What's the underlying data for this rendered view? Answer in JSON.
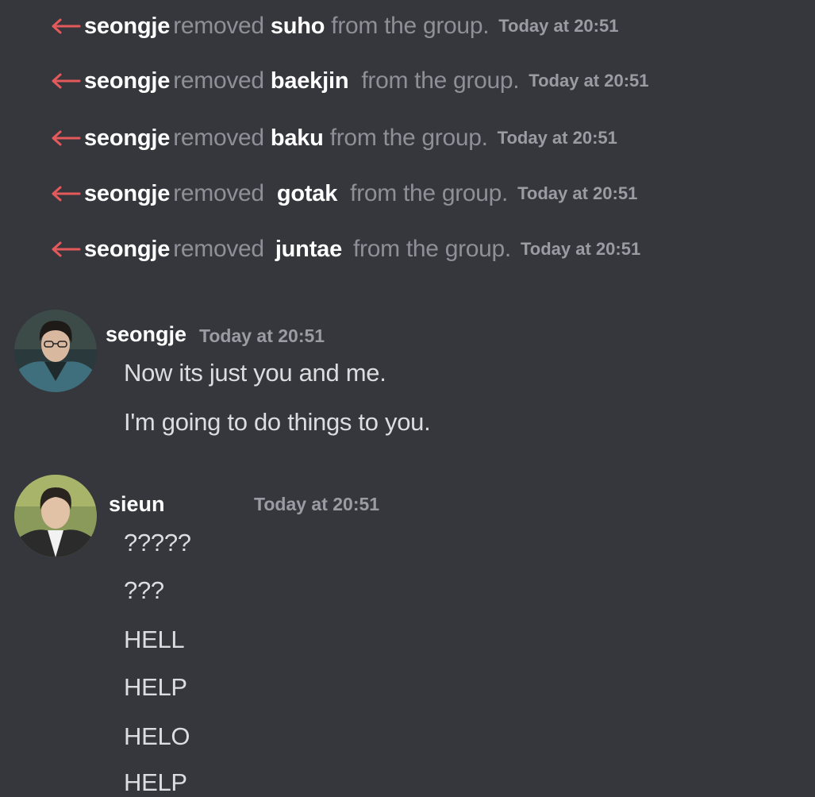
{
  "system_messages": [
    {
      "actor": "seongje",
      "verb": "removed",
      "target": "suho",
      "tail": "from the group.",
      "time": "Today at 20:51"
    },
    {
      "actor": "seongje",
      "verb": "removed",
      "target": "baekjin",
      "tail": "from the group.",
      "time": "Today at 20:51"
    },
    {
      "actor": "seongje",
      "verb": "removed",
      "target": "baku",
      "tail": "from the group.",
      "time": "Today at 20:51"
    },
    {
      "actor": "seongje",
      "verb": "removed",
      "target": "gotak",
      "tail": "from the group.",
      "time": "Today at 20:51"
    },
    {
      "actor": "seongje",
      "verb": "removed",
      "target": "juntae",
      "tail": "from the group.",
      "time": "Today at 20:51"
    }
  ],
  "message_groups": [
    {
      "username": "seongje",
      "time": "Today at 20:51",
      "messages": [
        "Now its just you and me.",
        "I'm going to do things to you."
      ]
    },
    {
      "username": "sieun",
      "time": "Today at 20:51",
      "messages": [
        "?????",
        "???",
        "HELL",
        "HELP",
        "HELO",
        "HELP"
      ]
    }
  ],
  "colors": {
    "background": "#36373d",
    "removed_arrow": "#e45a5a",
    "username": "#ffffff",
    "muted_text": "#8e9097",
    "message_text": "#dcdde1"
  }
}
